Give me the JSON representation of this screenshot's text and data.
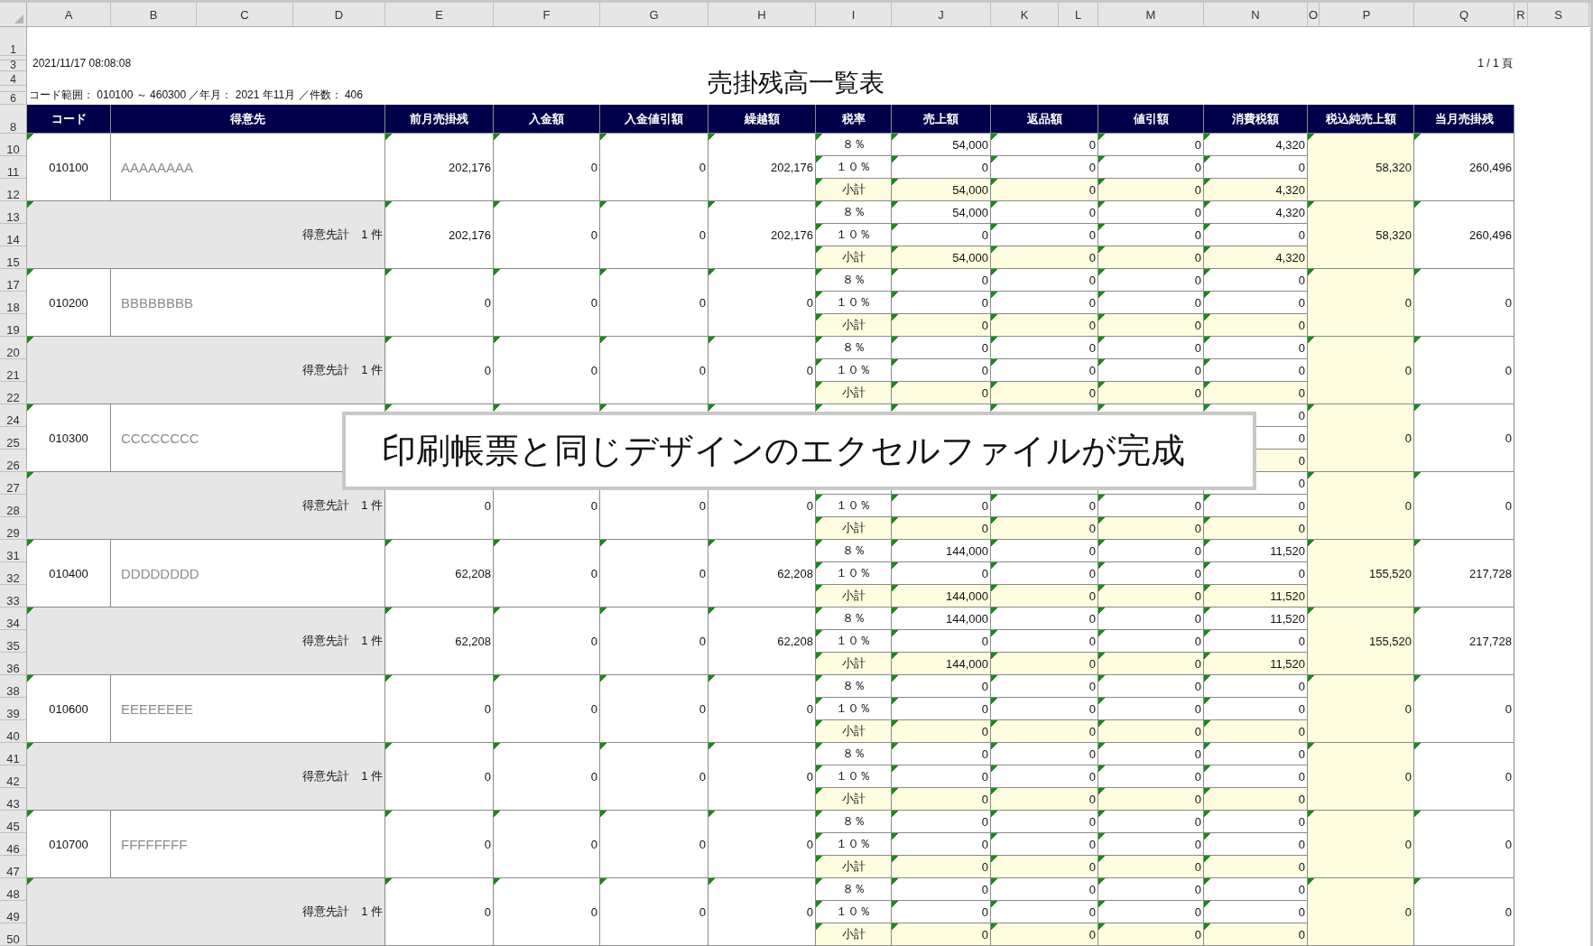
{
  "column_letters": [
    "A",
    "B",
    "C",
    "D",
    "E",
    "F",
    "G",
    "H",
    "I",
    "J",
    "K",
    "L",
    "M",
    "N",
    "O",
    "P",
    "Q",
    "R",
    "S"
  ],
  "top_rows": [
    "1",
    "",
    "3",
    "4",
    "",
    "6"
  ],
  "report": {
    "timestamp": "2021/11/17 08:08:08",
    "title": "売掛残高一覧表",
    "page": "1 / 1 頁",
    "criteria": "コード範囲： 010100 ～ 460300 ／年月： 2021 年11月 ／件数： 406"
  },
  "header": {
    "row": "8",
    "columns": [
      "コード",
      "得意先",
      "前月売掛残",
      "入金額",
      "入金値引額",
      "繰越額",
      "税率",
      "売上額",
      "返品額",
      "値引額",
      "消費税額",
      "税込純売上額",
      "当月売掛残"
    ]
  },
  "groups": [
    {
      "kind": "customer",
      "rows": [
        "10",
        "11",
        "12"
      ],
      "code": "010100",
      "name": "AAAAAAAA",
      "amounts": [
        "202,176",
        "0",
        "0",
        "202,176"
      ],
      "lines": [
        {
          "kind": "rate",
          "rate": "８％",
          "sales": "54,000",
          "returns": "0",
          "discount": "0",
          "tax": "4,320"
        },
        {
          "kind": "rate",
          "rate": "１０％",
          "sales": "0",
          "returns": "0",
          "discount": "0",
          "tax": "0"
        },
        {
          "kind": "subtotal",
          "rate": "小計",
          "sales": "54,000",
          "returns": "0",
          "discount": "0",
          "tax": "4,320"
        }
      ],
      "net_sales": "58,320",
      "balance": "260,496"
    },
    {
      "kind": "subtotal",
      "rows": [
        "13",
        "14",
        "15"
      ],
      "label": "得意先計　1 件",
      "amounts": [
        "202,176",
        "0",
        "0",
        "202,176"
      ],
      "lines": [
        {
          "kind": "rate",
          "rate": "８％",
          "sales": "54,000",
          "returns": "0",
          "discount": "0",
          "tax": "4,320"
        },
        {
          "kind": "rate",
          "rate": "１０％",
          "sales": "0",
          "returns": "0",
          "discount": "0",
          "tax": "0"
        },
        {
          "kind": "subtotal",
          "rate": "小計",
          "sales": "54,000",
          "returns": "0",
          "discount": "0",
          "tax": "4,320"
        }
      ],
      "net_sales": "58,320",
      "balance": "260,496"
    },
    {
      "kind": "customer",
      "rows": [
        "17",
        "18",
        "19"
      ],
      "code": "010200",
      "name": "BBBBBBBB",
      "amounts": [
        "0",
        "0",
        "0",
        "0"
      ],
      "lines": [
        {
          "kind": "rate",
          "rate": "８％",
          "sales": "0",
          "returns": "0",
          "discount": "0",
          "tax": "0"
        },
        {
          "kind": "rate",
          "rate": "１０％",
          "sales": "0",
          "returns": "0",
          "discount": "0",
          "tax": "0"
        },
        {
          "kind": "subtotal",
          "rate": "小計",
          "sales": "0",
          "returns": "0",
          "discount": "0",
          "tax": "0"
        }
      ],
      "net_sales": "0",
      "balance": "0"
    },
    {
      "kind": "subtotal",
      "rows": [
        "20",
        "21",
        "22"
      ],
      "label": "得意先計　1 件",
      "amounts": [
        "0",
        "0",
        "0",
        "0"
      ],
      "lines": [
        {
          "kind": "rate",
          "rate": "８％",
          "sales": "0",
          "returns": "0",
          "discount": "0",
          "tax": "0"
        },
        {
          "kind": "rate",
          "rate": "１０％",
          "sales": "0",
          "returns": "0",
          "discount": "0",
          "tax": "0"
        },
        {
          "kind": "subtotal",
          "rate": "小計",
          "sales": "0",
          "returns": "0",
          "discount": "0",
          "tax": "0"
        }
      ],
      "net_sales": "0",
      "balance": "0"
    },
    {
      "kind": "customer",
      "rows": [
        "24",
        "25",
        "26"
      ],
      "code": "010300",
      "name": "CCCCCCCC",
      "lines": [
        {
          "kind": "rate",
          "tax": "0"
        },
        {
          "kind": "rate",
          "tax": "0"
        },
        {
          "kind": "subtotal",
          "tax": "0"
        }
      ],
      "net_sales": "0",
      "balance": "0"
    },
    {
      "kind": "subtotal",
      "rows": [
        "27",
        "28",
        "29"
      ],
      "label": "得意先計　1 件",
      "amounts": [
        "0",
        "0",
        "0",
        "0"
      ],
      "lines": [
        {
          "kind": "rate",
          "tax": "0"
        },
        {
          "kind": "rate",
          "rate": "１０％",
          "sales": "0",
          "returns": "0",
          "discount": "0",
          "tax": "0"
        },
        {
          "kind": "subtotal",
          "rate": "小計",
          "sales": "0",
          "returns": "0",
          "discount": "0",
          "tax": "0"
        }
      ],
      "net_sales": "0",
      "balance": "0"
    },
    {
      "kind": "customer",
      "rows": [
        "31",
        "32",
        "33"
      ],
      "code": "010400",
      "name": "DDDDDDDD",
      "amounts": [
        "62,208",
        "0",
        "0",
        "62,208"
      ],
      "lines": [
        {
          "kind": "rate",
          "rate": "８％",
          "sales": "144,000",
          "returns": "0",
          "discount": "0",
          "tax": "11,520"
        },
        {
          "kind": "rate",
          "rate": "１０％",
          "sales": "0",
          "returns": "0",
          "discount": "0",
          "tax": "0"
        },
        {
          "kind": "subtotal",
          "rate": "小計",
          "sales": "144,000",
          "returns": "0",
          "discount": "0",
          "tax": "11,520"
        }
      ],
      "net_sales": "155,520",
      "balance": "217,728"
    },
    {
      "kind": "subtotal",
      "rows": [
        "34",
        "35",
        "36"
      ],
      "label": "得意先計　1 件",
      "amounts": [
        "62,208",
        "0",
        "0",
        "62,208"
      ],
      "lines": [
        {
          "kind": "rate",
          "rate": "８％",
          "sales": "144,000",
          "returns": "0",
          "discount": "0",
          "tax": "11,520"
        },
        {
          "kind": "rate",
          "rate": "１０％",
          "sales": "0",
          "returns": "0",
          "discount": "0",
          "tax": "0"
        },
        {
          "kind": "subtotal",
          "rate": "小計",
          "sales": "144,000",
          "returns": "0",
          "discount": "0",
          "tax": "11,520"
        }
      ],
      "net_sales": "155,520",
      "balance": "217,728"
    },
    {
      "kind": "customer",
      "rows": [
        "38",
        "39",
        "40"
      ],
      "code": "010600",
      "name": "EEEEEEEE",
      "amounts": [
        "0",
        "0",
        "0",
        "0"
      ],
      "lines": [
        {
          "kind": "rate",
          "rate": "８％",
          "sales": "0",
          "returns": "0",
          "discount": "0",
          "tax": "0"
        },
        {
          "kind": "rate",
          "rate": "１０％",
          "sales": "0",
          "returns": "0",
          "discount": "0",
          "tax": "0"
        },
        {
          "kind": "subtotal",
          "rate": "小計",
          "sales": "0",
          "returns": "0",
          "discount": "0",
          "tax": "0"
        }
      ],
      "net_sales": "0",
      "balance": "0"
    },
    {
      "kind": "subtotal",
      "rows": [
        "41",
        "42",
        "43"
      ],
      "label": "得意先計　1 件",
      "amounts": [
        "0",
        "0",
        "0",
        "0"
      ],
      "lines": [
        {
          "kind": "rate",
          "rate": "８％",
          "sales": "0",
          "returns": "0",
          "discount": "0",
          "tax": "0"
        },
        {
          "kind": "rate",
          "rate": "１０％",
          "sales": "0",
          "returns": "0",
          "discount": "0",
          "tax": "0"
        },
        {
          "kind": "subtotal",
          "rate": "小計",
          "sales": "0",
          "returns": "0",
          "discount": "0",
          "tax": "0"
        }
      ],
      "net_sales": "0",
      "balance": "0"
    },
    {
      "kind": "customer",
      "rows": [
        "45",
        "46",
        "47"
      ],
      "code": "010700",
      "name": "FFFFFFFF",
      "amounts": [
        "0",
        "0",
        "0",
        "0"
      ],
      "lines": [
        {
          "kind": "rate",
          "rate": "８％",
          "sales": "0",
          "returns": "0",
          "discount": "0",
          "tax": "0"
        },
        {
          "kind": "rate",
          "rate": "１０％",
          "sales": "0",
          "returns": "0",
          "discount": "0",
          "tax": "0"
        },
        {
          "kind": "subtotal",
          "rate": "小計",
          "sales": "0",
          "returns": "0",
          "discount": "0",
          "tax": "0"
        }
      ],
      "net_sales": "0",
      "balance": "0"
    },
    {
      "kind": "subtotal",
      "rows": [
        "48",
        "49",
        "50"
      ],
      "label": "得意先計　1 件",
      "amounts": [
        "0",
        "0",
        "0",
        "0"
      ],
      "lines": [
        {
          "kind": "rate",
          "rate": "８％",
          "sales": "0",
          "returns": "0",
          "discount": "0",
          "tax": "0"
        },
        {
          "kind": "rate",
          "rate": "１０％",
          "sales": "0",
          "returns": "0",
          "discount": "0",
          "tax": "0"
        },
        {
          "kind": "subtotal",
          "rate": "小計",
          "sales": "0",
          "returns": "0",
          "discount": "0",
          "tax": "0"
        }
      ],
      "net_sales": "0",
      "balance": "0"
    }
  ],
  "caption": "印刷帳票と同じデザインのエクセルファイルが完成"
}
